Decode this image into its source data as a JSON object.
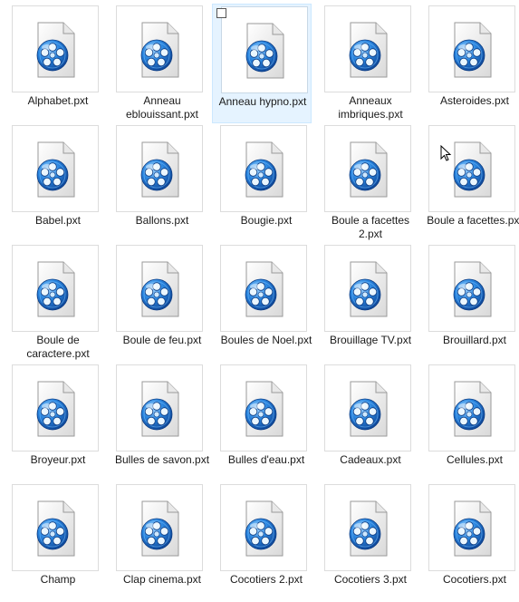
{
  "colors": {
    "selection_bg": "#e5f3ff",
    "selection_border": "#cce8ff",
    "icon_blue": "#1e6fd0"
  },
  "icon": "video-file-icon",
  "files": [
    {
      "name": "Alphabet.pxt"
    },
    {
      "name": "Anneau eblouissant.pxt"
    },
    {
      "name": "Anneau hypno.pxt",
      "selected": true
    },
    {
      "name": "Anneaux imbriques.pxt"
    },
    {
      "name": "Asteroides.pxt"
    },
    {
      "name": "Babel.pxt"
    },
    {
      "name": "Ballons.pxt"
    },
    {
      "name": "Bougie.pxt"
    },
    {
      "name": "Boule a facettes 2.pxt"
    },
    {
      "name": "Boule a facettes.pxt"
    },
    {
      "name": "Boule de caractere.pxt"
    },
    {
      "name": "Boule de feu.pxt"
    },
    {
      "name": "Boules de Noel.pxt"
    },
    {
      "name": "Brouillage TV.pxt"
    },
    {
      "name": "Brouillard.pxt"
    },
    {
      "name": "Broyeur.pxt"
    },
    {
      "name": "Bulles de savon.pxt"
    },
    {
      "name": "Bulles d'eau.pxt"
    },
    {
      "name": "Cadeaux.pxt"
    },
    {
      "name": "Cellules.pxt"
    },
    {
      "name": "Champ"
    },
    {
      "name": "Clap cinema.pxt"
    },
    {
      "name": "Cocotiers 2.pxt"
    },
    {
      "name": "Cocotiers 3.pxt"
    },
    {
      "name": "Cocotiers.pxt"
    }
  ]
}
